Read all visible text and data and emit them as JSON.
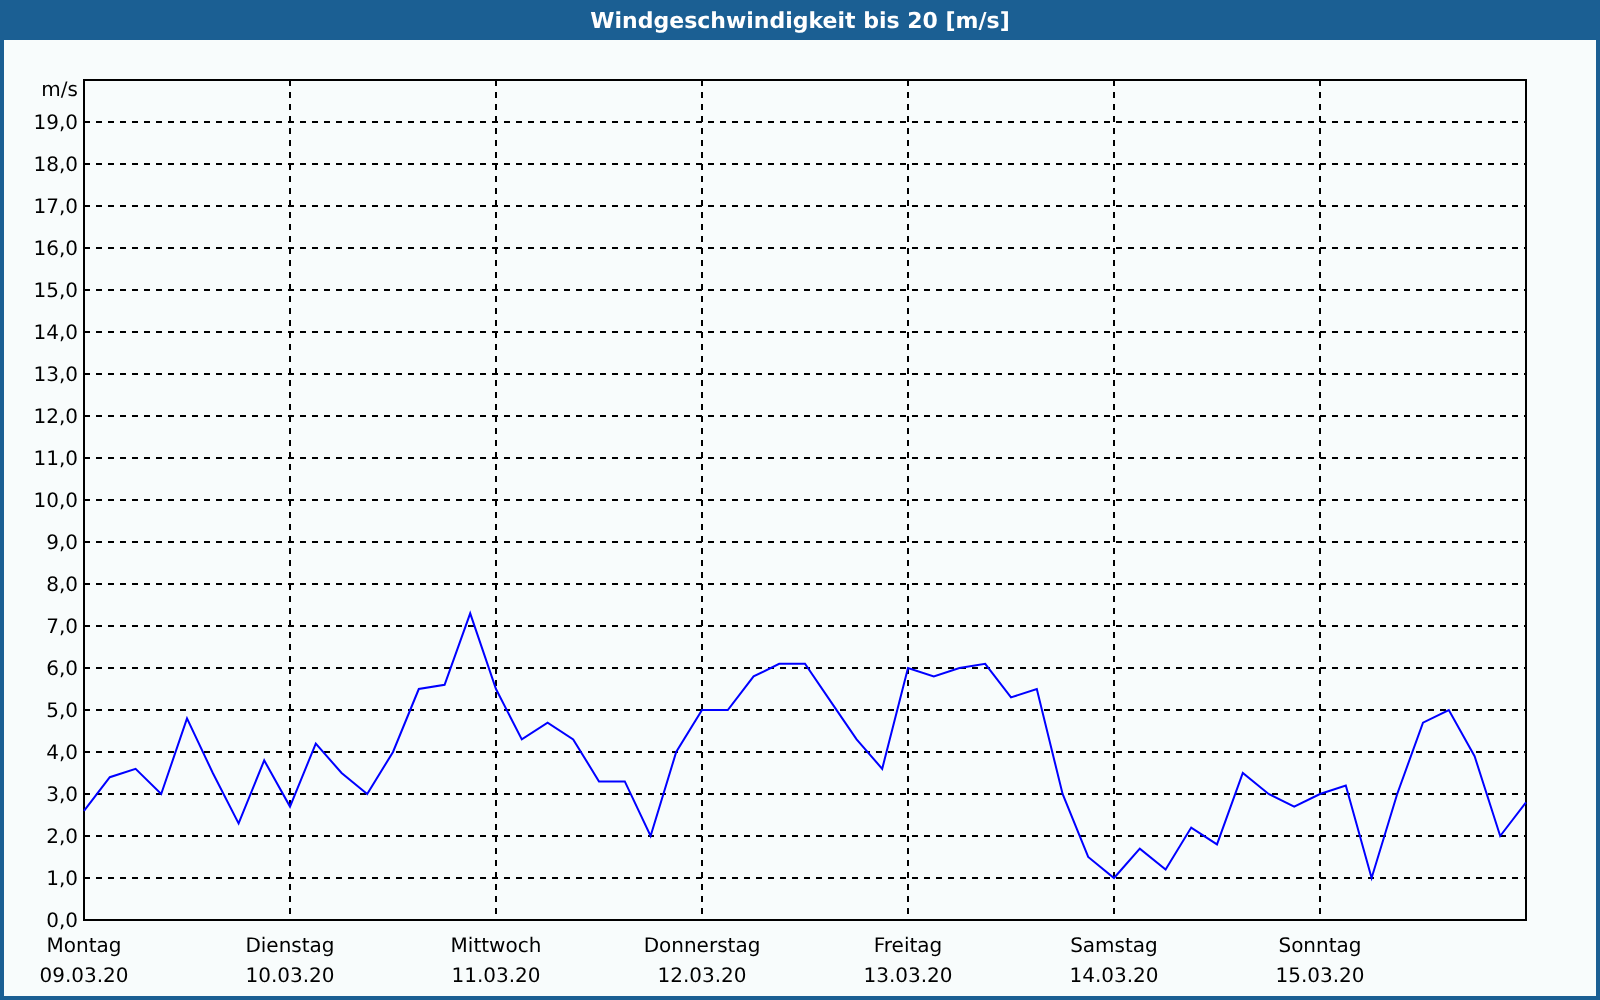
{
  "window": {
    "title": "Windgeschwindigkeit bis 20 [m/s]"
  },
  "chart": {
    "dates": [
      "09.03.20",
      "10.03.20",
      "11.03.20",
      "12.03.20",
      "13.03.20",
      "14.03.20",
      "15.03.20"
    ],
    "chart_data": {
      "type": "line",
      "grid": true,
      "ylabel": "m/s",
      "ylim": [
        0,
        20
      ],
      "yticks": [
        {
          "value": 0,
          "label": "0,0"
        },
        {
          "value": 1,
          "label": "1,0"
        },
        {
          "value": 2,
          "label": "2,0"
        },
        {
          "value": 3,
          "label": "3,0"
        },
        {
          "value": 4,
          "label": "4,0"
        },
        {
          "value": 5,
          "label": "5,0"
        },
        {
          "value": 6,
          "label": "6,0"
        },
        {
          "value": 7,
          "label": "7,0"
        },
        {
          "value": 8,
          "label": "8,0"
        },
        {
          "value": 9,
          "label": "9,0"
        },
        {
          "value": 10,
          "label": "10,0"
        },
        {
          "value": 11,
          "label": "11,0"
        },
        {
          "value": 12,
          "label": "12,0"
        },
        {
          "value": 13,
          "label": "13,0"
        },
        {
          "value": 14,
          "label": "14,0"
        },
        {
          "value": 15,
          "label": "15,0"
        },
        {
          "value": 16,
          "label": "16,0"
        },
        {
          "value": 17,
          "label": "17,0"
        },
        {
          "value": 18,
          "label": "18,0"
        },
        {
          "value": 19,
          "label": "19,0"
        }
      ],
      "categories": [
        "Montag",
        null,
        null,
        null,
        null,
        null,
        null,
        null,
        "Dienstag",
        null,
        null,
        null,
        null,
        null,
        null,
        null,
        "Mittwoch",
        null,
        null,
        null,
        null,
        null,
        null,
        null,
        "Donnerstag",
        null,
        null,
        null,
        null,
        null,
        null,
        null,
        "Freitag",
        null,
        null,
        null,
        null,
        null,
        null,
        null,
        "Samstag",
        null,
        null,
        null,
        null,
        null,
        null,
        null,
        "Sonntag",
        null,
        null,
        null,
        null,
        null,
        null,
        null,
        null
      ],
      "series": [
        {
          "color": "#0000ff",
          "values": [
            2.6,
            3.4,
            3.6,
            3.0,
            4.8,
            3.5,
            2.3,
            3.8,
            2.7,
            4.2,
            3.5,
            3.0,
            4.0,
            5.5,
            5.6,
            7.3,
            5.5,
            4.3,
            4.7,
            4.3,
            3.3,
            3.3,
            2.0,
            4.0,
            5.0,
            5.0,
            5.8,
            6.1,
            6.1,
            5.2,
            4.3,
            3.6,
            6.0,
            5.8,
            6.0,
            6.1,
            5.3,
            5.5,
            3.0,
            1.5,
            1.0,
            1.7,
            1.2,
            2.2,
            1.8,
            3.5,
            3.0,
            2.7,
            3.0,
            3.2,
            1.0,
            3.0,
            4.7,
            5.0,
            3.9,
            2.0,
            2.8
          ]
        }
      ]
    }
  }
}
